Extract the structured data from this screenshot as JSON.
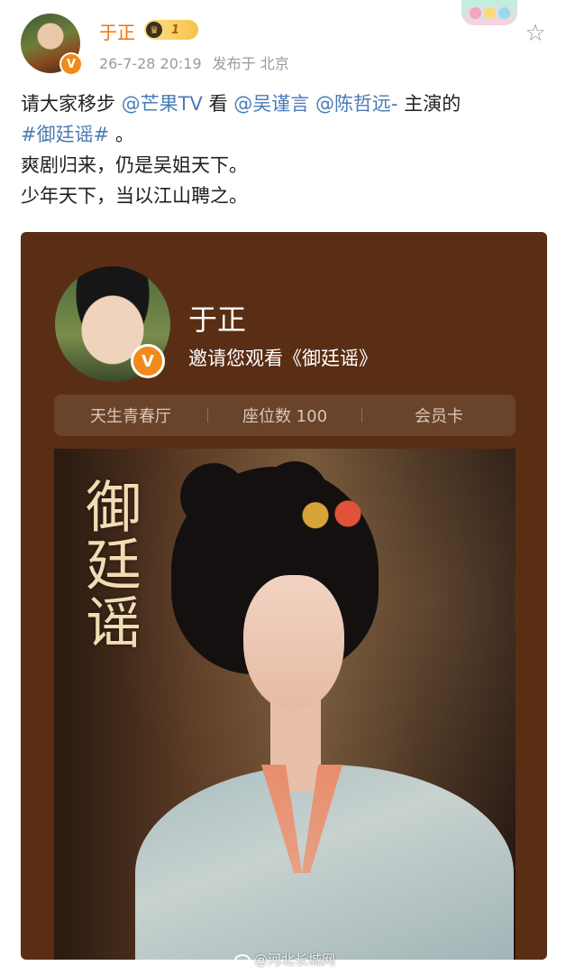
{
  "header": {
    "username": "于正",
    "vip_level": "1",
    "timestamp": "26-7-28 20:19",
    "location": "发布于 北京"
  },
  "post": {
    "line1": {
      "prefix": "请大家移步 ",
      "mention1": "@芒果TV",
      "mid1": " 看 ",
      "mention2": "@吴谨言",
      "mid2": " ",
      "mention3": "@陈哲远-",
      "suffix": " 主演的"
    },
    "hashtag": "#御廷谣#",
    "hashtag_suffix": " 。",
    "line3": "爽剧归来，仍是吴姐天下。",
    "line4": "少年天下，当以江山聘之。"
  },
  "card": {
    "name": "于正",
    "invite_text": "邀请您观看《御廷谣》",
    "info": [
      "天生青春厅",
      "座位数 100",
      "会员卡"
    ],
    "poster_title": "御廷谣"
  },
  "watermark": "@河北长城网",
  "colors": {
    "username": "#f0730a",
    "link": "#4a7bb5",
    "card_bg": "#5a2e14",
    "verified_badge": "#f08a1a"
  }
}
